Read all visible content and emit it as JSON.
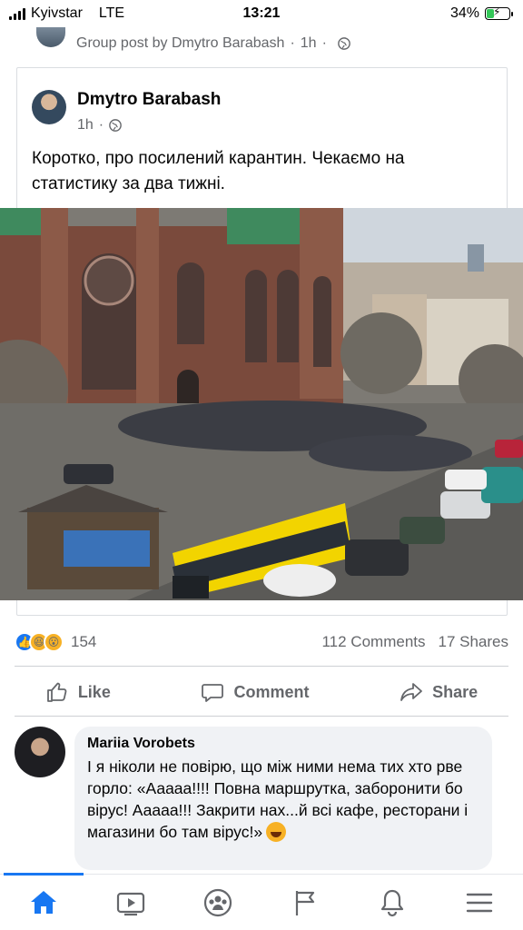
{
  "status_bar": {
    "carrier": "Kyivstar",
    "network": "LTE",
    "time": "13:21",
    "battery_percent": "34%",
    "battery_level": 0.34,
    "charging": true
  },
  "group_post": {
    "label": "Group post by Dmytro Barabash",
    "time": "1h"
  },
  "shared_post": {
    "author": "Dmytro Barabash",
    "time": "1h",
    "text": "Коротко, про посилений карантин. Чекаємо на статистику за два тижні.",
    "photo_icon": "street-crowd-photo"
  },
  "engagement": {
    "reaction_count": "154",
    "comments": "112 Comments",
    "shares": "17 Shares",
    "reaction_icons": [
      "like-icon",
      "haha-icon",
      "wow-icon"
    ]
  },
  "actions": {
    "like": "Like",
    "comment": "Comment",
    "share": "Share"
  },
  "comment": {
    "author": "Mariia Vorobets",
    "text": "І я ніколи не повірю, що між ними нема тих хто рве горло: «Ааааа!!!! Повна маршрутка, заборонити бо вірус! Ааааа!!! Закрити нах...й всі кафе, ресторани і магазини бо там вірус!»"
  },
  "bottom_nav": {
    "items": [
      "home-icon",
      "watch-icon",
      "groups-icon",
      "pages-icon",
      "notifications-icon",
      "menu-icon"
    ],
    "active": "home-icon"
  },
  "colors": {
    "accent": "#1877f2",
    "secondary_text": "#65676b",
    "comment_bubble": "#f0f2f5",
    "battery_green": "#34c759"
  }
}
